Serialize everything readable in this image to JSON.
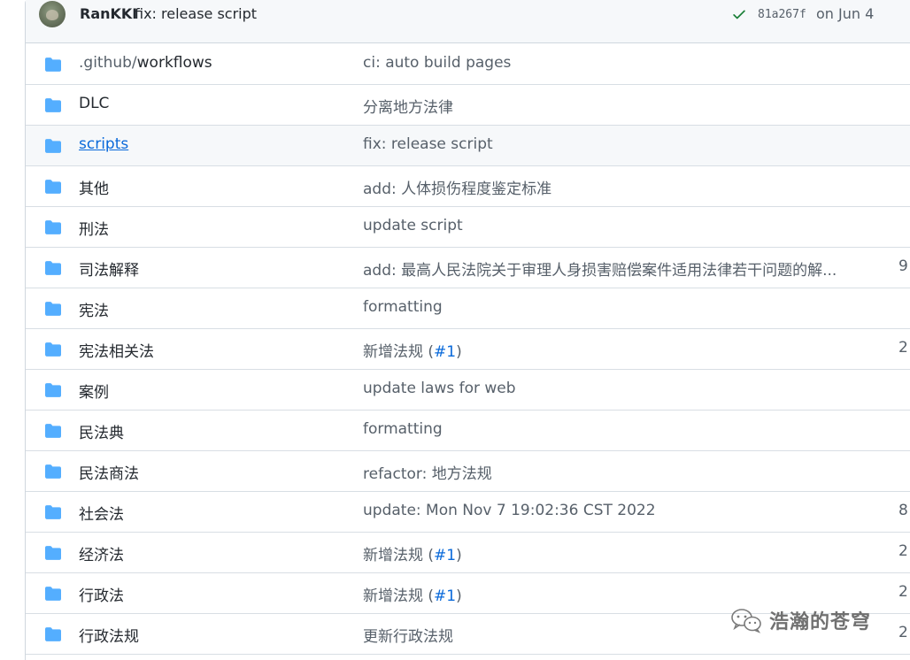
{
  "commit": {
    "author": "RanKKI",
    "message": "fix: release script",
    "sha": "81a267f",
    "date": "on Jun 4",
    "status": "success"
  },
  "colors": {
    "folder": "#54aeff",
    "link": "#0969da",
    "success": "#1a7f37"
  },
  "files": [
    {
      "name_prefix": ".github/",
      "name": "workflows",
      "message": "ci: auto build pages",
      "age": ""
    },
    {
      "name": "DLC",
      "message": "分离地方法律",
      "age": ""
    },
    {
      "name": "scripts",
      "message": "fix: release script",
      "age": ""
    },
    {
      "name": "其他",
      "message": "add: 人体损伤程度鉴定标准",
      "age": ""
    },
    {
      "name": "刑法",
      "message": "update script",
      "age": ""
    },
    {
      "name": "司法解释",
      "message": "add: 最高人民法院关于审理人身损害赔偿案件适用法律若干问题的解...",
      "age": "9"
    },
    {
      "name": "宪法",
      "message": "formatting",
      "age": ""
    },
    {
      "name": "宪法相关法",
      "message": "新增法规 (",
      "issue": "#1",
      "message_end": ")",
      "age": "2"
    },
    {
      "name": "案例",
      "message": "update laws for web",
      "age": ""
    },
    {
      "name": "民法典",
      "message": "formatting",
      "age": ""
    },
    {
      "name": "民法商法",
      "message": "refactor: 地方法规",
      "age": ""
    },
    {
      "name": "社会法",
      "message": "update: Mon Nov 7 19:02:36 CST 2022",
      "age": "8"
    },
    {
      "name": "经济法",
      "message": "新增法规 (",
      "issue": "#1",
      "message_end": ")",
      "age": "2"
    },
    {
      "name": "行政法",
      "message": "新增法规 (",
      "issue": "#1",
      "message_end": ")",
      "age": "2"
    },
    {
      "name": "行政法规",
      "message": "更新行政法规",
      "age": "2"
    }
  ],
  "watermark": {
    "text": "浩瀚的苍穹",
    "icon": "wechat-icon"
  }
}
